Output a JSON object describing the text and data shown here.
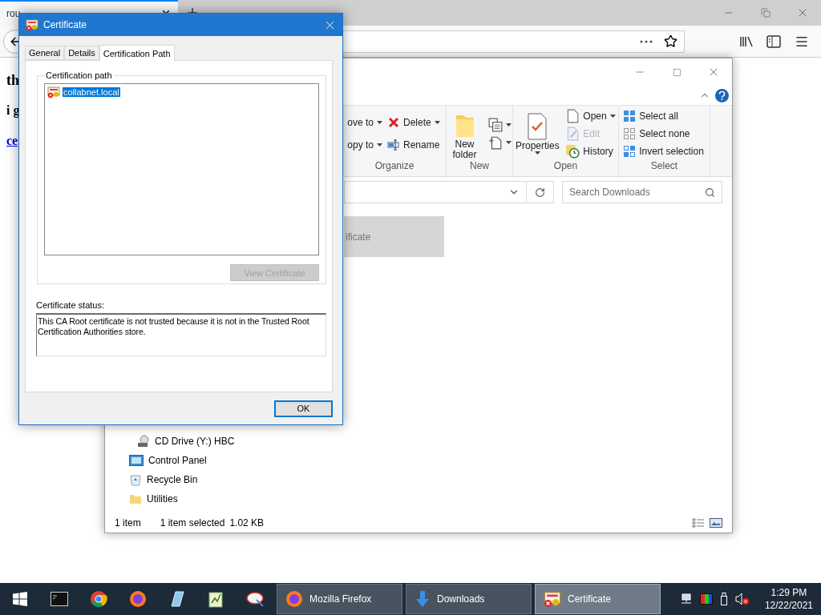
{
  "browser": {
    "tab": {
      "title": "rou"
    },
    "page": [
      {
        "kind": "heading",
        "text": "th"
      },
      {
        "kind": "strong",
        "text": "i g"
      },
      {
        "kind": "link",
        "text": "ce"
      }
    ]
  },
  "explorer": {
    "ribbon": [
      {
        "label": "Organize",
        "columns": [
          [
            {
              "kind": "text",
              "label": "ove to",
              "dropdown": true,
              "disabled": false
            },
            {
              "kind": "text",
              "label": "opy to",
              "dropdown": true,
              "disabled": false
            }
          ],
          [
            {
              "kind": "delete",
              "label": "Delete",
              "dropdown": true,
              "disabled": false
            },
            {
              "kind": "rename",
              "label": "Rename",
              "dropdown": false,
              "disabled": false
            }
          ]
        ]
      },
      {
        "label": "New",
        "columns": [
          [
            {
              "kind": "new-folder",
              "label": "New folder",
              "dropdown": false,
              "disabled": false
            }
          ],
          [
            {
              "kind": "new-item",
              "dropdown": true,
              "disabled": false
            },
            {
              "kind": "easy-access",
              "dropdown": true,
              "disabled": false
            }
          ]
        ]
      },
      {
        "label": "Open",
        "columns": [
          [
            {
              "kind": "properties",
              "label": "Properties",
              "dropdown": true,
              "disabled": false
            }
          ],
          [
            {
              "kind": "open",
              "label": "Open",
              "dropdown": true,
              "disabled": false
            },
            {
              "kind": "edit",
              "label": "Edit",
              "dropdown": false,
              "disabled": true
            },
            {
              "kind": "history",
              "label": "History",
              "dropdown": false,
              "disabled": false
            }
          ]
        ]
      },
      {
        "label": "Select",
        "columns": [
          [
            {
              "kind": "select-all",
              "label": "Select all",
              "dropdown": false,
              "disabled": false
            },
            {
              "kind": "select-none",
              "label": "Select none",
              "dropdown": false,
              "disabled": false
            },
            {
              "kind": "invert",
              "label": "Invert selection",
              "dropdown": false,
              "disabled": false
            }
          ]
        ]
      }
    ],
    "search": {
      "placeholder": "Search Downloads"
    },
    "tile": {
      "label": "ificate",
      "selected": true
    },
    "nav": [
      {
        "kind": "drive",
        "label": "CD Drive (Y:) HBC"
      },
      {
        "kind": "control-panel",
        "label": "Control Panel"
      },
      {
        "kind": "recycle-bin",
        "label": "Recycle Bin"
      },
      {
        "kind": "folder",
        "label": "Utilities"
      }
    ],
    "status": {
      "count": "1 item",
      "selection": "1 item selected",
      "size": "1.02 KB"
    }
  },
  "dialog": {
    "title": "Certificate",
    "tabs": [
      {
        "label": "General",
        "selected": false
      },
      {
        "label": "Details",
        "selected": false
      },
      {
        "label": "Certification Path",
        "selected": true
      }
    ],
    "path_label": "Certification path",
    "path": [
      {
        "label": "collabnet.local",
        "selected": true
      }
    ],
    "view_button": {
      "label": "View Certificate",
      "disabled": true
    },
    "status_label": "Certificate status:",
    "status_text": "This CA Root certificate is not trusted because it is not in the Trusted Root Certification Authorities store.",
    "ok_button": {
      "label": "OK",
      "default": true
    }
  },
  "taskbar": {
    "tasks": [
      {
        "kind": "firefox",
        "label": "Mozilla Firefox",
        "selected": false
      },
      {
        "kind": "downloads",
        "label": "Downloads",
        "selected": false
      },
      {
        "kind": "certificate",
        "label": "Certificate",
        "selected": true
      }
    ],
    "clock": {
      "time": "1:29 PM",
      "date": "12/22/2021"
    }
  }
}
